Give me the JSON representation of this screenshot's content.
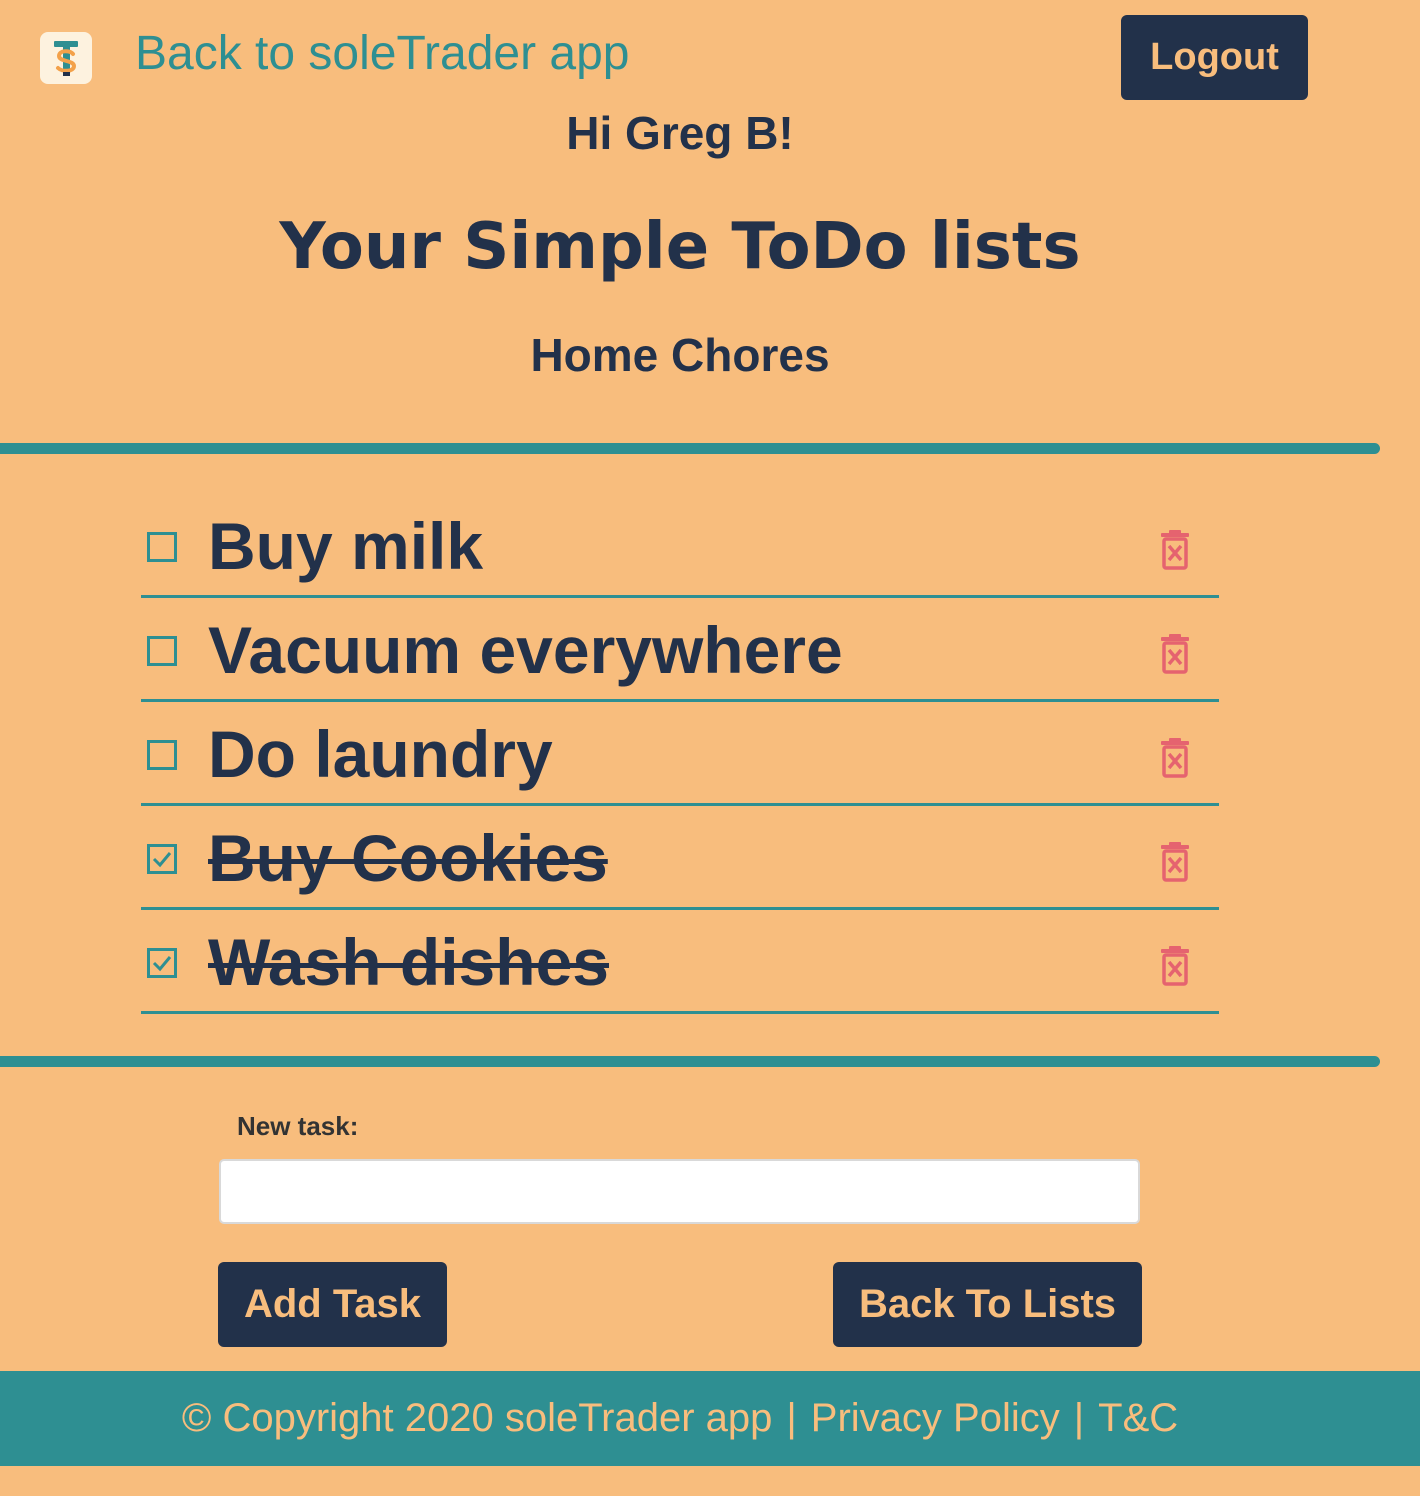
{
  "header": {
    "back_link": "Back to soleTrader app",
    "logout_label": "Logout"
  },
  "greeting": "Hi Greg B!",
  "page_title": "Your Simple ToDo lists",
  "list_name": "Home Chores",
  "tasks": [
    {
      "label": "Buy milk",
      "done": false
    },
    {
      "label": "Vacuum everywhere",
      "done": false
    },
    {
      "label": "Do laundry",
      "done": false
    },
    {
      "label": "Buy Cookies",
      "done": true
    },
    {
      "label": "Wash dishes",
      "done": true
    }
  ],
  "new_task": {
    "label": "New task:",
    "value": "",
    "placeholder": ""
  },
  "buttons": {
    "add_task": "Add Task",
    "back_to_lists": "Back To Lists"
  },
  "footer": {
    "copyright": "© Copyright 2020 soleTrader app",
    "separator": "|",
    "privacy": "Privacy Policy",
    "terms": "T&C"
  },
  "colors": {
    "background": "#f8bd7d",
    "navy": "#22314a",
    "teal": "#2e8f92",
    "delete": "#e5636f"
  },
  "icons": {
    "logo": "soletrader-logo-icon",
    "checkbox": "checkbox-icon",
    "check": "checkmark-icon",
    "delete": "trash-icon"
  }
}
